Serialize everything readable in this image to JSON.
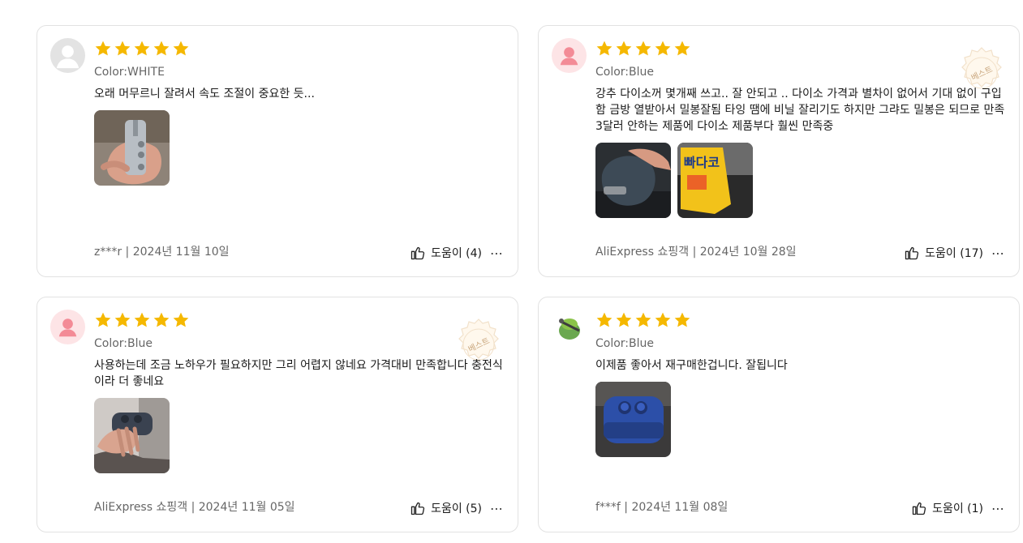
{
  "colors": {
    "star": "#f5b800",
    "text": "#191919",
    "muted": "#666666",
    "border": "#e2e2e2"
  },
  "reviews": [
    {
      "avatar": "default-gray-avatar",
      "rating": 5,
      "color_label": "Color:WHITE",
      "text": "오래 머무르니 잘려서 속도 조절이 중요한 듯...",
      "meta": "z***r | 2024년 11월 10일",
      "helpful": "도움이 (4)",
      "images": [
        "silver-sealer-photo"
      ]
    },
    {
      "avatar": "default-pink-avatar",
      "rating": 5,
      "color_label": "Color:Blue",
      "text": "강추 다이소꺼 몇개째 쓰고.. 잘 안되고 .. 다이소 가격과 별차이 없어서 기대 없이 구입함 금방 열받아서 밀봉잘됨 타잉 땜에 비닐 잘리기도 하지만 그랴도 밀봉은 되므로 만족 3달러 안하는 제품에 다이소 제품부다 훨씬 만족중",
      "meta": "AliExpress 쇼핑객 | 2024년 10월 28일",
      "helpful": "도움이 (17)",
      "badge": "베스트",
      "images": [
        "blue-sealer-photo",
        "snack-bag-photo"
      ],
      "snack_label": "빠다코"
    },
    {
      "avatar": "default-pink-avatar",
      "rating": 5,
      "color_label": "Color:Blue",
      "text": "사용하는데 조금 노하우가 필요하지만 그리 어렵지 않네요 가격대비 만족합니다 충전식이라 더 좋네요",
      "meta": "AliExpress 쇼핑객 | 2024년 11월 05일",
      "helpful": "도움이 (5)",
      "badge": "베스트",
      "images": [
        "hand-sealer-photo"
      ]
    },
    {
      "avatar": "custom-photo-avatar",
      "rating": 5,
      "color_label": "Color:Blue",
      "text": "이제품 좋아서 재구매한겁니다. 잘됩니다",
      "meta": "f***f | 2024년 11월 08일",
      "helpful": "도움이 (1)",
      "images": [
        "blue-sealer-top-photo"
      ]
    }
  ]
}
